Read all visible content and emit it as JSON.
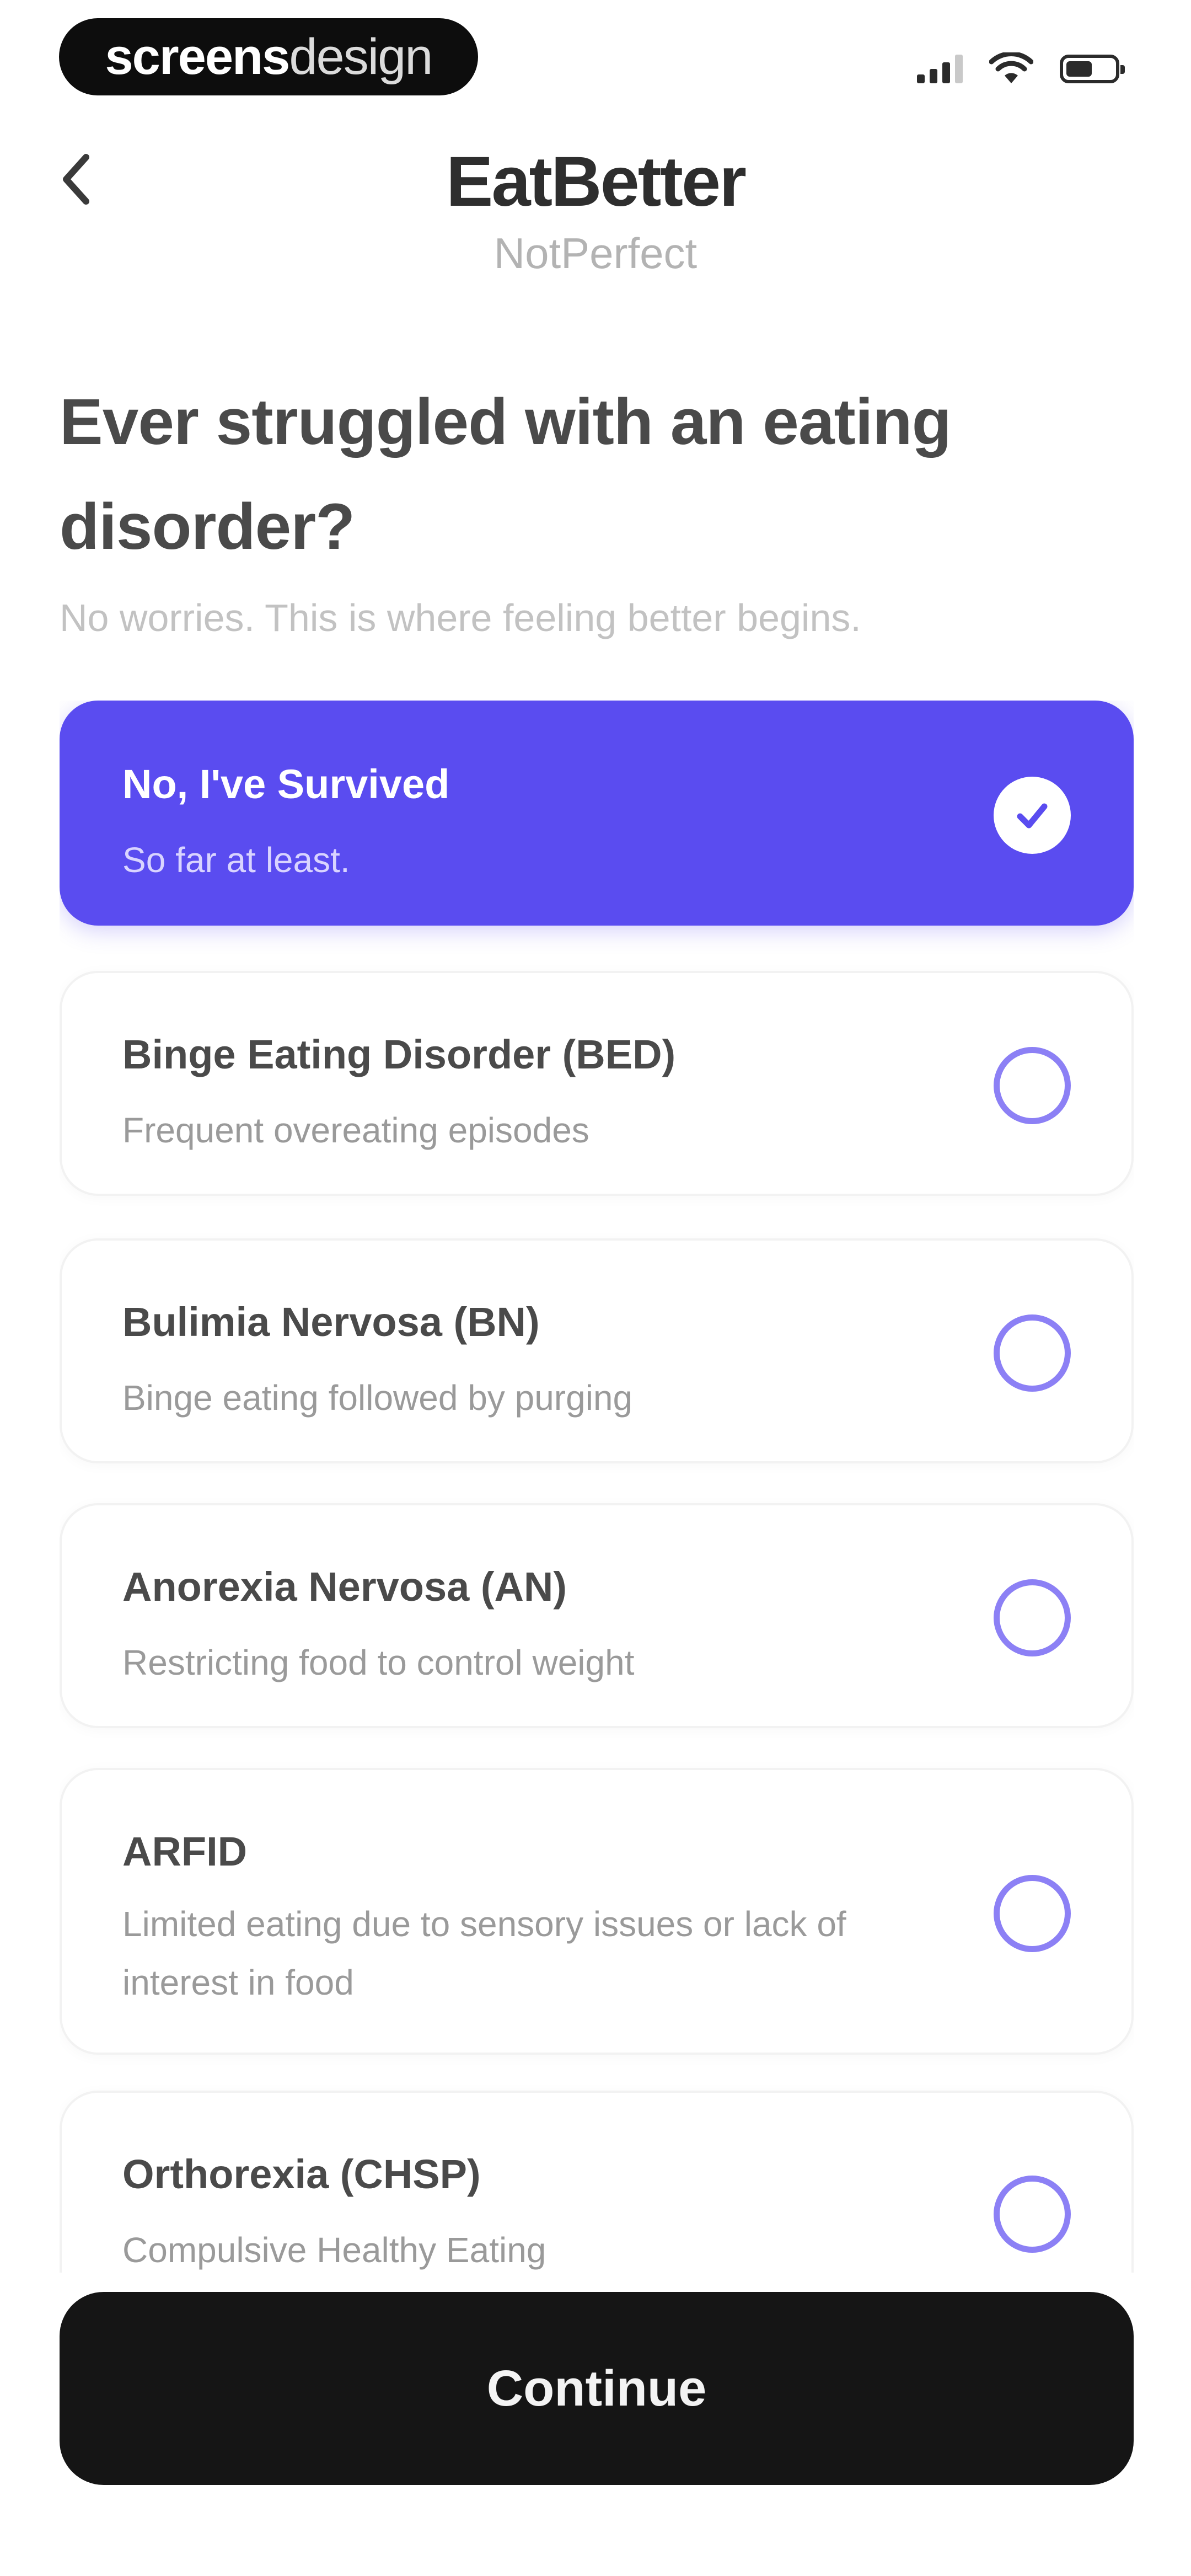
{
  "status_bar": {
    "badge_bold": "screens",
    "badge_light": "design"
  },
  "header": {
    "title": "EatBetter",
    "subtitle": "NotPerfect",
    "back_icon": "chevron-left-icon"
  },
  "question": {
    "title": "Ever struggled with an eating disorder?",
    "subtitle": "No worries. This is where feeling better begins."
  },
  "options": [
    {
      "label": "No, I've Survived",
      "description": "So far at least.",
      "selected": true
    },
    {
      "label": "Binge Eating Disorder (BED)",
      "description": "Frequent overeating episodes",
      "selected": false
    },
    {
      "label": "Bulimia Nervosa (BN)",
      "description": "Binge eating followed by purging",
      "selected": false
    },
    {
      "label": "Anorexia Nervosa (AN)",
      "description": "Restricting food to control weight",
      "selected": false
    },
    {
      "label": "ARFID",
      "description": "Limited eating due to sensory issues or lack of interest in food",
      "selected": false
    },
    {
      "label": "Orthorexia (CHSP)",
      "description": "Compulsive Healthy Eating",
      "selected": false
    }
  ],
  "continue_label": "Continue",
  "colors": {
    "accent": "#5a4cf0",
    "radio_ring": "#8c80f5",
    "button": "#151515"
  }
}
